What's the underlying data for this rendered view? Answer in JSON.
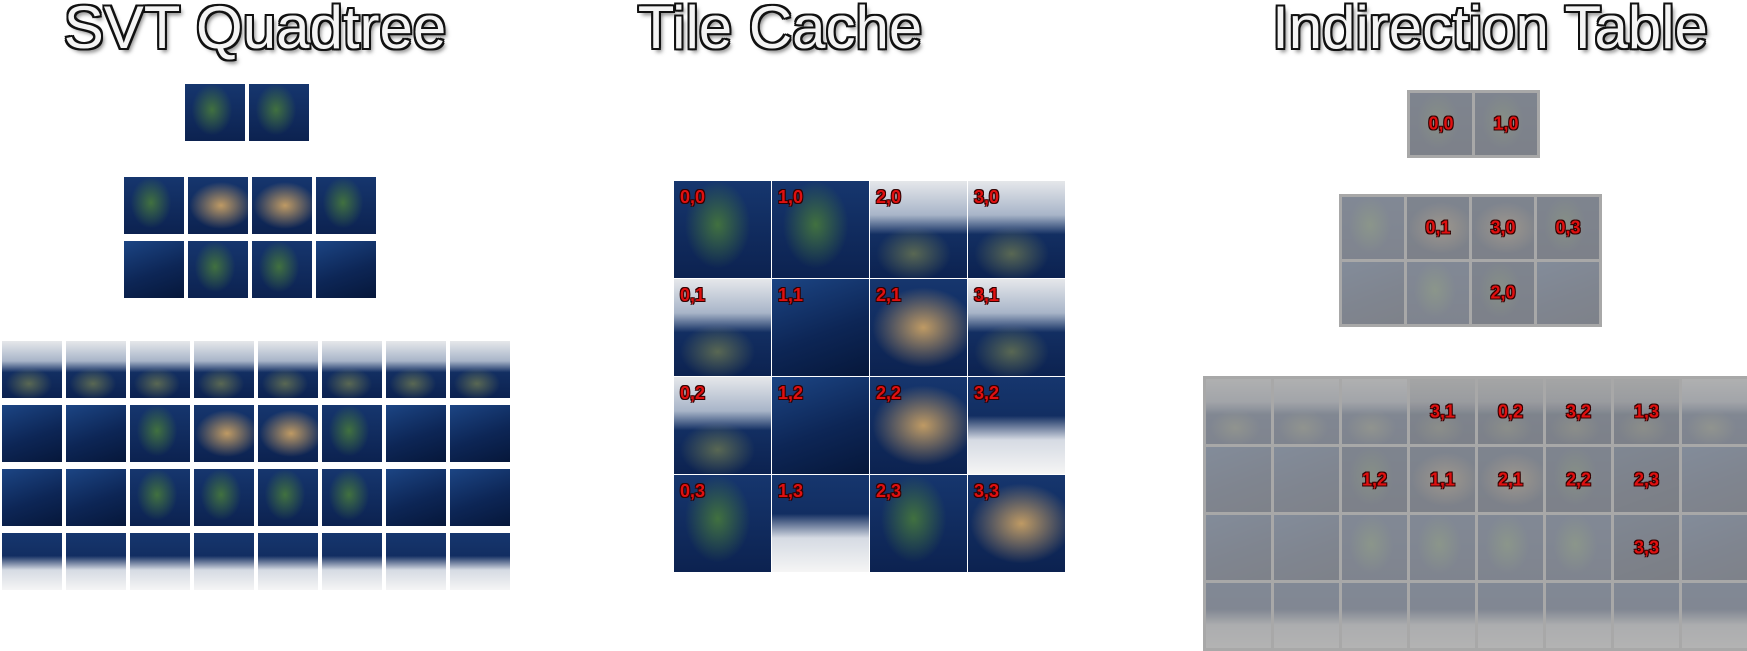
{
  "titles": {
    "quadtree": "SVT Quadtree",
    "cache": "Tile Cache",
    "indirection": "Indirection Table"
  },
  "colors": {
    "label_red": "#e01010",
    "grid_gray": "#a8a8a8",
    "ocean_blue": "#0f2a5a"
  },
  "quadtree_levels": [
    {
      "cols": 2,
      "rows": 1
    },
    {
      "cols": 4,
      "rows": 2
    },
    {
      "cols": 8,
      "rows": 4
    }
  ],
  "tile_cache": {
    "cols": 4,
    "rows": 4,
    "cells": [
      [
        "0,0",
        "1,0",
        "2,0",
        "3,0"
      ],
      [
        "0,1",
        "1,1",
        "2,1",
        "3,1"
      ],
      [
        "0,2",
        "1,2",
        "2,2",
        "3,2"
      ],
      [
        "0,3",
        "1,3",
        "2,3",
        "3,3"
      ]
    ]
  },
  "indirection_table": {
    "level0": [
      [
        "0,0",
        "1,0"
      ]
    ],
    "level1": [
      [
        "",
        "0,1",
        "3,0",
        "0,3"
      ],
      [
        "",
        "",
        "2,0",
        ""
      ]
    ],
    "level2": [
      [
        "",
        "",
        "",
        "3,1",
        "0,2",
        "3,2",
        "1,3",
        ""
      ],
      [
        "",
        "",
        "1,2",
        "1,1",
        "2,1",
        "2,2",
        "2,3",
        ""
      ],
      [
        "",
        "",
        "",
        "",
        "",
        "",
        "3,3",
        ""
      ],
      [
        "",
        "",
        "",
        "",
        "",
        "",
        "",
        ""
      ]
    ]
  }
}
